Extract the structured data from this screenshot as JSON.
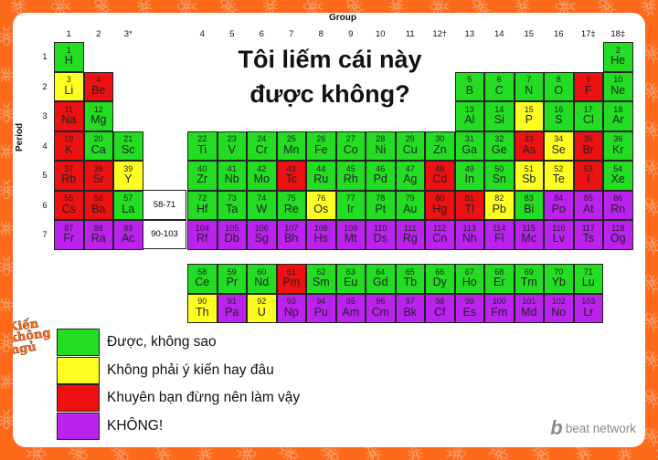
{
  "title": {
    "line1": "Tôi liếm cái này",
    "line2": "được không?"
  },
  "axis": {
    "group_title": "Group",
    "period_title": "Period"
  },
  "groups": [
    "1",
    "2",
    "3*",
    "4",
    "5",
    "6",
    "7",
    "8",
    "9",
    "10",
    "11",
    "12†",
    "13",
    "14",
    "15",
    "16",
    "17‡",
    "18‡"
  ],
  "periods": [
    "1",
    "2",
    "3",
    "4",
    "5",
    "6",
    "7"
  ],
  "placeholders": [
    "58-71",
    "90-103"
  ],
  "colors": {
    "G": "#22dd22",
    "Y": "#ffff22",
    "R": "#ee1111",
    "P": "#bb22ee"
  },
  "elements": [
    [
      1,
      "H",
      "G"
    ],
    [
      2,
      "He",
      "G"
    ],
    [
      3,
      "Li",
      "Y"
    ],
    [
      4,
      "Be",
      "R"
    ],
    [
      5,
      "B",
      "G"
    ],
    [
      6,
      "C",
      "G"
    ],
    [
      7,
      "N",
      "G"
    ],
    [
      8,
      "O",
      "G"
    ],
    [
      9,
      "F",
      "R"
    ],
    [
      10,
      "Ne",
      "G"
    ],
    [
      11,
      "Na",
      "R"
    ],
    [
      12,
      "Mg",
      "G"
    ],
    [
      13,
      "Al",
      "G"
    ],
    [
      14,
      "Si",
      "G"
    ],
    [
      15,
      "P",
      "Y"
    ],
    [
      16,
      "S",
      "G"
    ],
    [
      17,
      "Cl",
      "G"
    ],
    [
      18,
      "Ar",
      "G"
    ],
    [
      19,
      "K",
      "R"
    ],
    [
      20,
      "Ca",
      "G"
    ],
    [
      21,
      "Sc",
      "G"
    ],
    [
      22,
      "Ti",
      "G"
    ],
    [
      23,
      "V",
      "G"
    ],
    [
      24,
      "Cr",
      "G"
    ],
    [
      25,
      "Mn",
      "G"
    ],
    [
      26,
      "Fe",
      "G"
    ],
    [
      27,
      "Co",
      "G"
    ],
    [
      28,
      "Ni",
      "G"
    ],
    [
      29,
      "Cu",
      "G"
    ],
    [
      30,
      "Zn",
      "G"
    ],
    [
      31,
      "Ga",
      "G"
    ],
    [
      32,
      "Ge",
      "G"
    ],
    [
      33,
      "As",
      "R"
    ],
    [
      34,
      "Se",
      "Y"
    ],
    [
      35,
      "Br",
      "R"
    ],
    [
      36,
      "Kr",
      "G"
    ],
    [
      37,
      "Rb",
      "R"
    ],
    [
      38,
      "Sr",
      "R"
    ],
    [
      39,
      "Y",
      "Y"
    ],
    [
      40,
      "Zr",
      "G"
    ],
    [
      41,
      "Nb",
      "G"
    ],
    [
      42,
      "Mo",
      "G"
    ],
    [
      43,
      "Tc",
      "R"
    ],
    [
      44,
      "Ru",
      "G"
    ],
    [
      45,
      "Rh",
      "G"
    ],
    [
      46,
      "Pd",
      "G"
    ],
    [
      47,
      "Ag",
      "G"
    ],
    [
      48,
      "Cd",
      "R"
    ],
    [
      49,
      "In",
      "G"
    ],
    [
      50,
      "Sn",
      "G"
    ],
    [
      51,
      "Sb",
      "Y"
    ],
    [
      52,
      "Te",
      "Y"
    ],
    [
      53,
      "I",
      "R"
    ],
    [
      54,
      "Xe",
      "G"
    ],
    [
      55,
      "Cs",
      "R"
    ],
    [
      56,
      "Ba",
      "R"
    ],
    [
      57,
      "La",
      "G"
    ],
    [
      72,
      "Hf",
      "G"
    ],
    [
      73,
      "Ta",
      "G"
    ],
    [
      74,
      "W",
      "G"
    ],
    [
      75,
      "Re",
      "G"
    ],
    [
      76,
      "Os",
      "Y"
    ],
    [
      77,
      "Ir",
      "G"
    ],
    [
      78,
      "Pt",
      "G"
    ],
    [
      79,
      "Au",
      "G"
    ],
    [
      80,
      "Hg",
      "R"
    ],
    [
      81,
      "Tl",
      "R"
    ],
    [
      82,
      "Pb",
      "Y"
    ],
    [
      83,
      "Bi",
      "G"
    ],
    [
      84,
      "Po",
      "P"
    ],
    [
      85,
      "At",
      "P"
    ],
    [
      86,
      "Rn",
      "P"
    ],
    [
      87,
      "Fr",
      "P"
    ],
    [
      88,
      "Ra",
      "P"
    ],
    [
      89,
      "Ac",
      "P"
    ],
    [
      104,
      "Rf",
      "P"
    ],
    [
      105,
      "Db",
      "P"
    ],
    [
      106,
      "Sg",
      "P"
    ],
    [
      107,
      "Bh",
      "P"
    ],
    [
      108,
      "Hs",
      "P"
    ],
    [
      109,
      "Mt",
      "P"
    ],
    [
      110,
      "Ds",
      "P"
    ],
    [
      111,
      "Rg",
      "P"
    ],
    [
      112,
      "Cn",
      "P"
    ],
    [
      113,
      "Nh",
      "P"
    ],
    [
      114,
      "Fl",
      "P"
    ],
    [
      115,
      "Mc",
      "P"
    ],
    [
      116,
      "Lv",
      "P"
    ],
    [
      117,
      "Ts",
      "P"
    ],
    [
      118,
      "Og",
      "P"
    ],
    [
      58,
      "Ce",
      "G"
    ],
    [
      59,
      "Pr",
      "G"
    ],
    [
      60,
      "Nd",
      "G"
    ],
    [
      61,
      "Pm",
      "R"
    ],
    [
      62,
      "Sm",
      "G"
    ],
    [
      63,
      "Eu",
      "G"
    ],
    [
      64,
      "Gd",
      "G"
    ],
    [
      65,
      "Tb",
      "G"
    ],
    [
      66,
      "Dy",
      "G"
    ],
    [
      67,
      "Ho",
      "G"
    ],
    [
      68,
      "Er",
      "G"
    ],
    [
      69,
      "Tm",
      "G"
    ],
    [
      70,
      "Yb",
      "G"
    ],
    [
      71,
      "Lu",
      "G"
    ],
    [
      90,
      "Th",
      "Y"
    ],
    [
      91,
      "Pa",
      "P"
    ],
    [
      92,
      "U",
      "Y"
    ],
    [
      93,
      "Np",
      "P"
    ],
    [
      94,
      "Pu",
      "P"
    ],
    [
      95,
      "Am",
      "P"
    ],
    [
      96,
      "Cm",
      "P"
    ],
    [
      97,
      "Bk",
      "P"
    ],
    [
      98,
      "Cf",
      "P"
    ],
    [
      99,
      "Es",
      "P"
    ],
    [
      100,
      "Fm",
      "P"
    ],
    [
      101,
      "Md",
      "P"
    ],
    [
      102,
      "No",
      "P"
    ],
    [
      103,
      "Lr",
      "P"
    ]
  ],
  "legend": [
    {
      "color": "G",
      "label": "Được, không sao"
    },
    {
      "color": "Y",
      "label": "Không phải ý kiến hay đâu"
    },
    {
      "color": "R",
      "label": "Khuyên bạn đừng nên làm vậy"
    },
    {
      "color": "P",
      "label": "KHÔNG!"
    }
  ],
  "logo_text": "Kiến không ngủ",
  "brand": {
    "mark": "b",
    "name": "beat network"
  }
}
